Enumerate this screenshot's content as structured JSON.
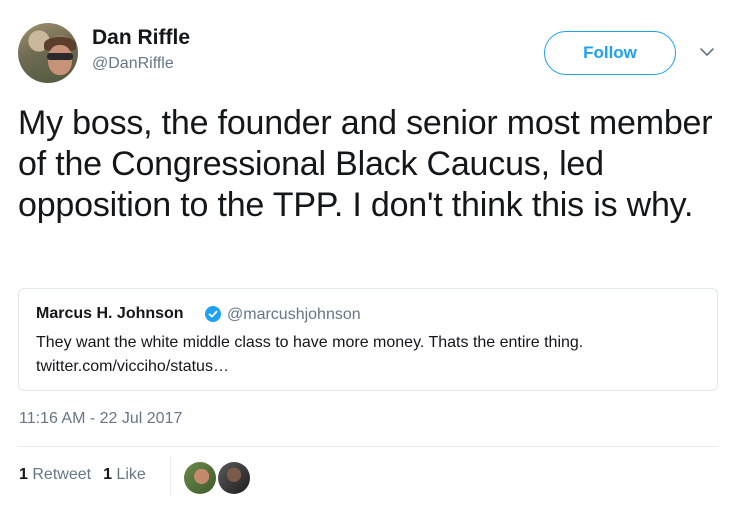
{
  "author": {
    "name": "Dan Riffle",
    "handle": "@DanRiffle"
  },
  "follow_label": "Follow",
  "tweet": {
    "text": "My boss, the founder and senior most member of the Congressional Black Caucus, led opposition to the TPP. I don't think this is why."
  },
  "quoted_tweet": {
    "name": "Marcus H. Johnson",
    "handle": "@marcushjohnson",
    "text": "They want the white middle class to have more money. Thats the entire thing.",
    "link": "twitter.com/vicciho/status…"
  },
  "timestamp": "11:16 AM - 22 Jul 2017",
  "stats": {
    "retweets_count": "1",
    "retweets_label": "Retweet",
    "likes_count": "1",
    "likes_label": "Like"
  },
  "colors": {
    "accent": "#1da1f2",
    "secondary_text": "#657786",
    "border": "#e1e8ed"
  }
}
